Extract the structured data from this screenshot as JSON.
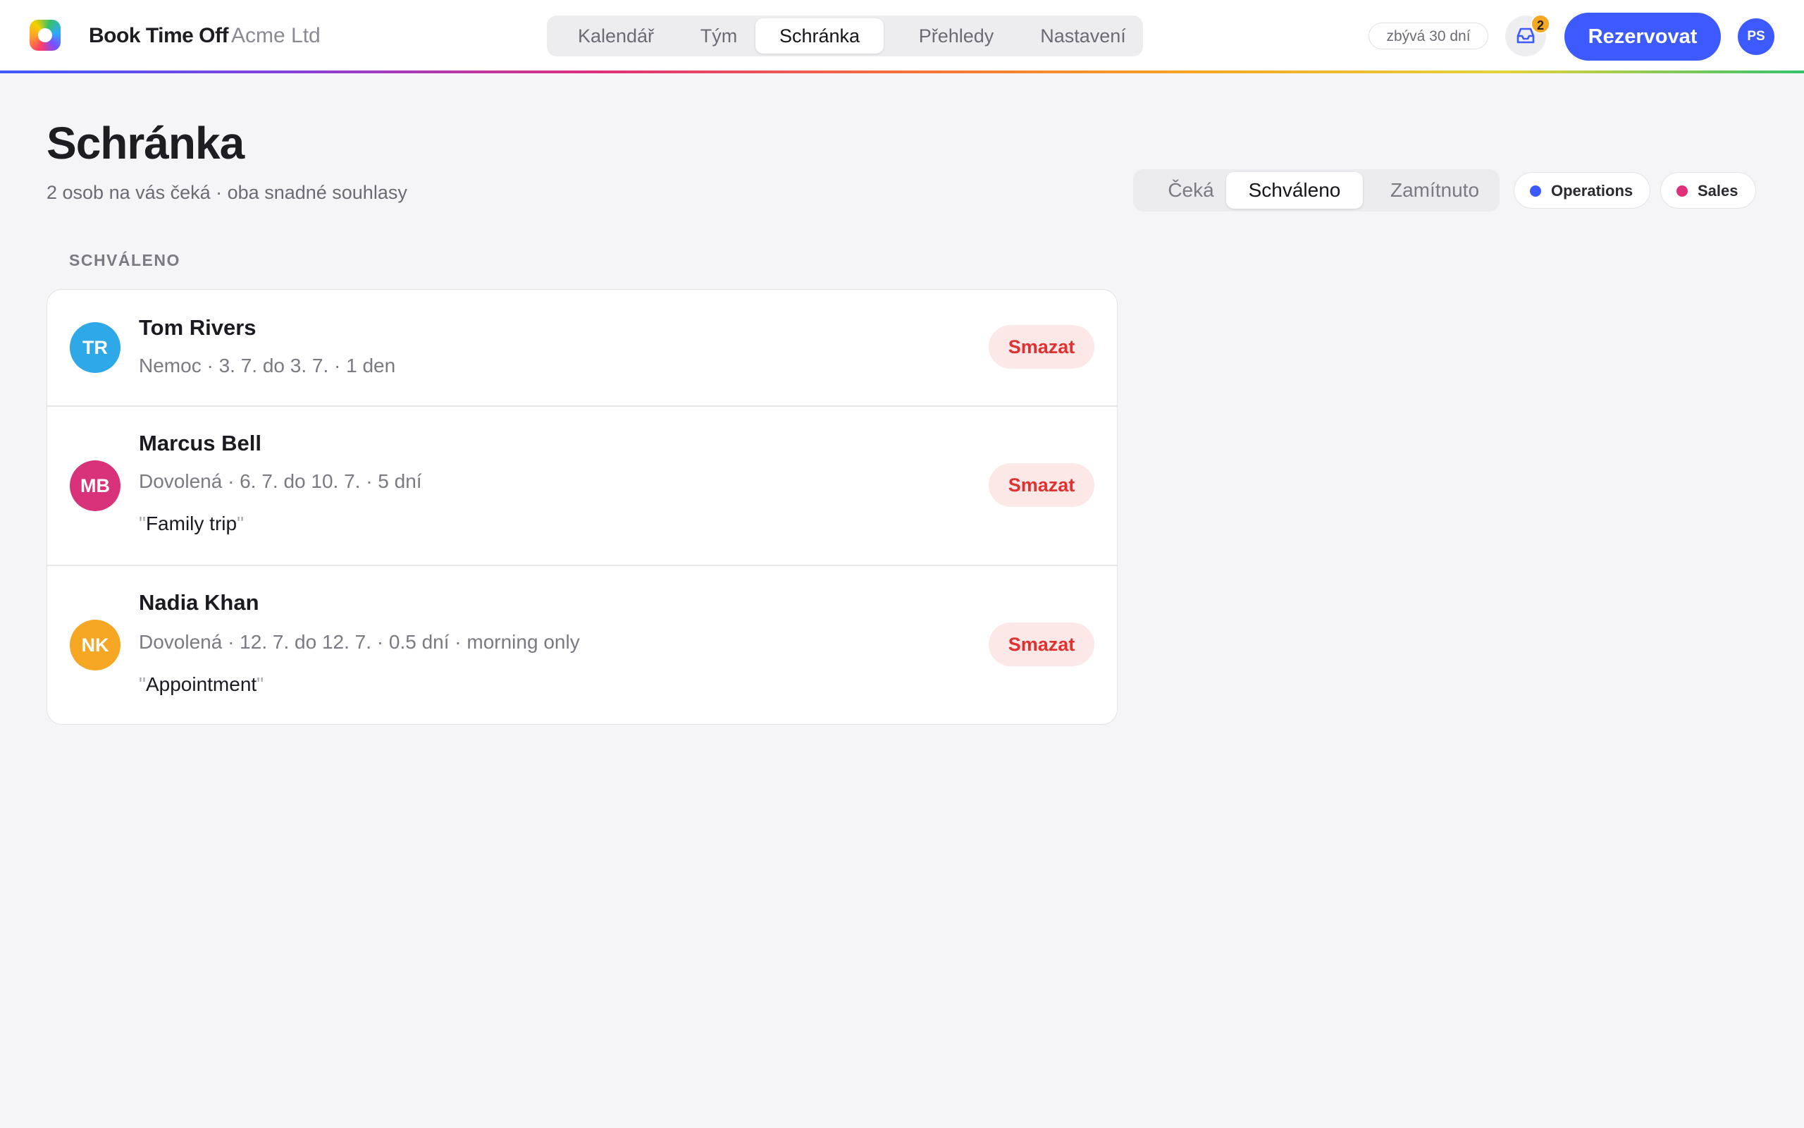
{
  "app": {
    "name": "Book Time Off",
    "company": "Acme Ltd"
  },
  "nav": {
    "tabs": [
      {
        "label": "Kalendář"
      },
      {
        "label": "Tým"
      },
      {
        "label": "Schránka"
      },
      {
        "label": "Přehledy"
      },
      {
        "label": "Nastavení"
      }
    ],
    "active": "Schránka"
  },
  "header": {
    "remaining_days": "zbývá 30 dní",
    "inbox_count": "2",
    "book_label": "Rezervovat",
    "user_initials": "PS"
  },
  "page": {
    "title": "Schránka",
    "subtitle": "2 osob na vás čeká · oba snadné souhlasy"
  },
  "status_filter": {
    "options": [
      {
        "label": "Čeká"
      },
      {
        "label": "Schváleno"
      },
      {
        "label": "Zamítnuto"
      }
    ],
    "active": "Schváleno"
  },
  "teams": [
    {
      "label": "Operations",
      "color": "#3d5afe"
    },
    {
      "label": "Sales",
      "color": "#e0307a"
    }
  ],
  "list": {
    "section_label": "SCHVÁLENO",
    "action_label": "Smazat",
    "items": [
      {
        "initials": "TR",
        "name": "Tom Rivers",
        "meta": "Nemoc · 3. 7. do 3. 7. · 1 den",
        "note": "",
        "color": "#2fa8e8"
      },
      {
        "initials": "MB",
        "name": "Marcus Bell",
        "meta": "Dovolená · 6. 7. do 10. 7. · 5 dní",
        "note": "Family trip",
        "color": "#d8327a"
      },
      {
        "initials": "NK",
        "name": "Nadia Khan",
        "meta": "Dovolená · 12. 7. do 12. 7. · 0.5 dní · morning only",
        "note": "Appointment",
        "color": "#f5a623"
      }
    ]
  },
  "colors": {
    "accent": "#3d5afe",
    "danger": "#e0302f",
    "danger_bg": "#fde8e8",
    "rainbow": [
      "#3d5afe",
      "#8a3fd8",
      "#e0307a",
      "#f5713a",
      "#f5a623",
      "#e6d23a",
      "#34c26a"
    ]
  }
}
